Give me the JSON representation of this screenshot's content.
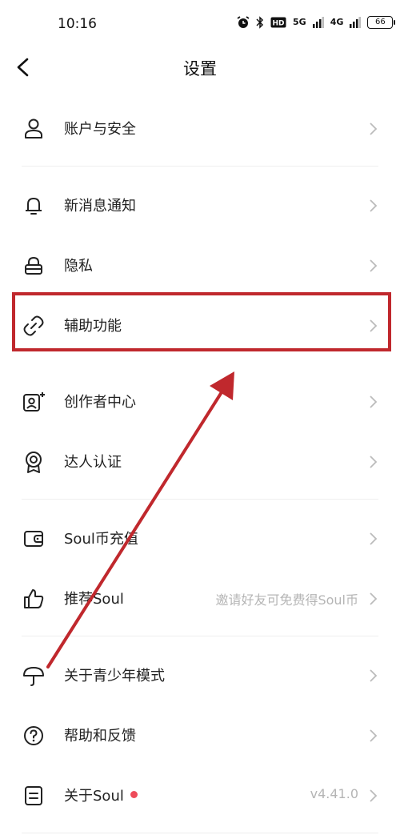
{
  "status_bar": {
    "time": "10:16",
    "net1": "5G",
    "net2": "4G",
    "battery": "66"
  },
  "header": {
    "title": "设置"
  },
  "items": [
    {
      "label": "账户与安全",
      "icon": "user-icon"
    },
    {
      "label": "新消息通知",
      "icon": "bell-icon"
    },
    {
      "label": "隐私",
      "icon": "lock-icon"
    },
    {
      "label": "辅助功能",
      "icon": "link-icon"
    },
    {
      "label": "创作者中心",
      "icon": "creator-icon"
    },
    {
      "label": "达人认证",
      "icon": "badge-icon"
    },
    {
      "label": "Soul币充值",
      "icon": "wallet-icon"
    },
    {
      "label": "推荐Soul",
      "icon": "thumbs-up-icon",
      "hint": "邀请好友可免费得Soul币"
    },
    {
      "label": "关于青少年模式",
      "icon": "umbrella-icon"
    },
    {
      "label": "帮助和反馈",
      "icon": "help-icon"
    },
    {
      "label": "关于Soul",
      "icon": "info-doc-icon",
      "hint": "v4.41.0"
    }
  ],
  "colors": {
    "highlight": "#c0282d",
    "badge_dot": "#ee4b5a"
  }
}
